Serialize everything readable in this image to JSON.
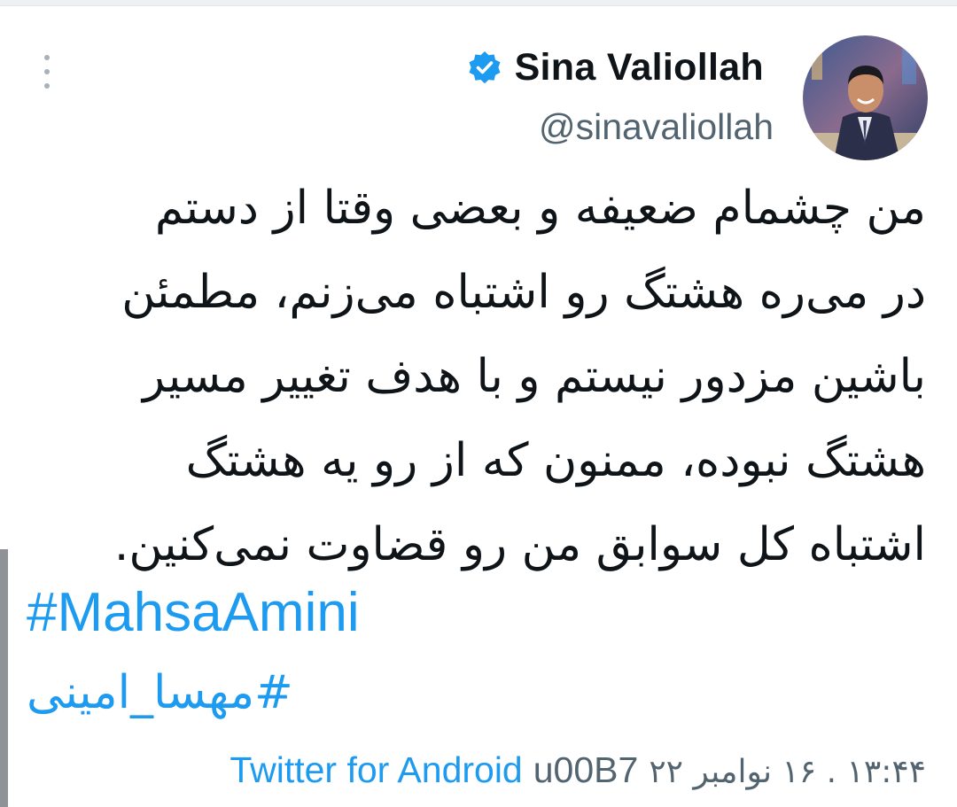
{
  "tweet": {
    "author": {
      "display_name": "Sina Valiollah",
      "handle": "@sinavaliollah",
      "verified": true,
      "verified_icon": "verified-badge-icon",
      "avatar": "profile-photo"
    },
    "more_icon": "more-vertical-icon",
    "text_lines": [
      "من چشمام ضعیفه و بعضی وقتا از دستم",
      "در می‌ره هشتگ رو اشتباه می‌زنم، مطمئن",
      "باشین مزدور نیستم و با هدف تغییر مسیر",
      "هشتگ نبوده، ممنون که از رو یه هشتگ",
      "اشتباه کل سوابق من رو قضاوت نمی‌کنین."
    ],
    "hashtags": [
      "#MahsaAmini",
      "#مهسا_امینی"
    ],
    "timestamp": "۱۳:۴۴ . ۱۶ نوامبر ۲۲",
    "separator": "u00B7",
    "source": "Twitter for Android"
  },
  "colors": {
    "accent": "#1d9bf0",
    "text": "#0f1419",
    "secondary": "#536471"
  }
}
